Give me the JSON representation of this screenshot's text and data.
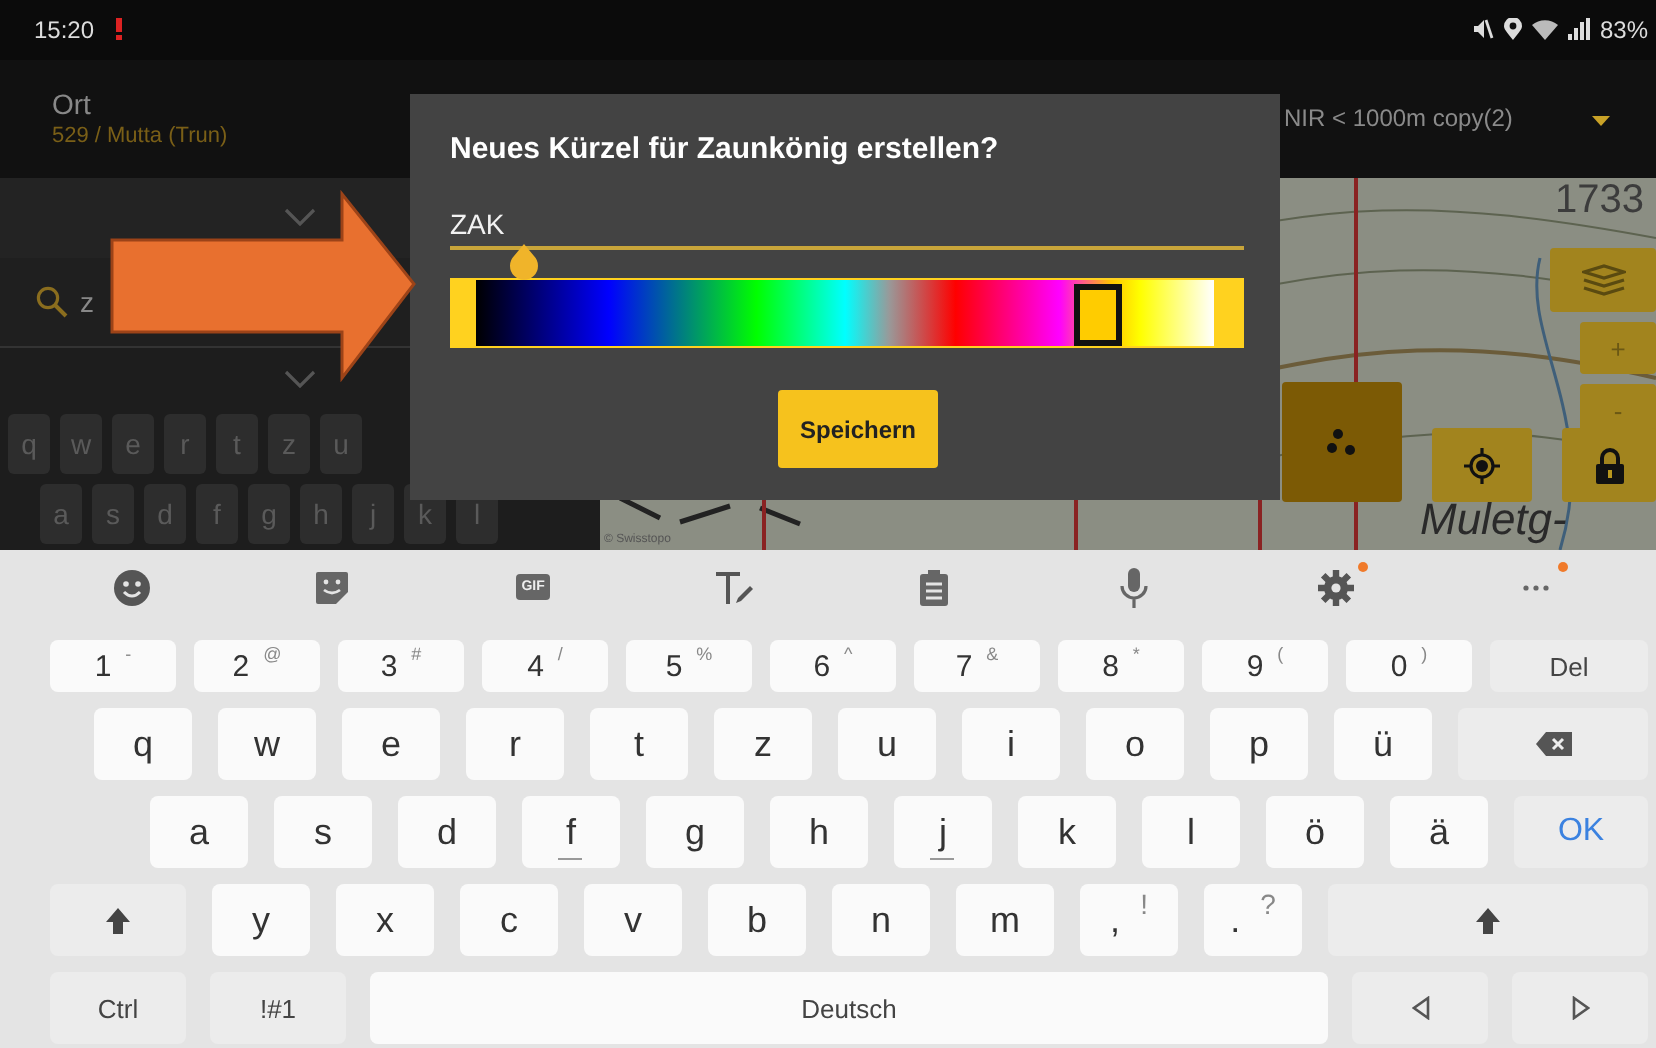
{
  "status_bar": {
    "time": "15:20",
    "battery": "83%"
  },
  "header": {
    "title": "Ort",
    "subtitle": "529 / Mutta (Trun)",
    "layer": "NIR < 1000m copy(2)"
  },
  "search": {
    "value": "z"
  },
  "background_keyboard": [
    [
      "q",
      "w",
      "e",
      "r",
      "t",
      "z",
      "u"
    ],
    [
      "a",
      "s",
      "d",
      "f",
      "g",
      "h",
      "j",
      "k",
      "l"
    ]
  ],
  "map": {
    "elevation": "1733",
    "place": "Muletg-",
    "attribution": "© Swisstopo"
  },
  "map_controls": [
    {
      "kind": "layers"
    },
    {
      "kind": "zoom",
      "label": "+"
    },
    {
      "kind": "zoom",
      "label": "-"
    },
    {
      "kind": "cluster"
    },
    {
      "kind": "locate"
    },
    {
      "kind": "lock"
    }
  ],
  "dialog": {
    "title": "Neues Kürzel für Zaunkönig erstellen?",
    "input": {
      "value": "ZAK"
    },
    "color_slider": {
      "level": 0.84
    },
    "button": "Speichern"
  },
  "keyboard": {
    "toolbar": [
      {
        "kind": "emoji",
        "badge": false
      },
      {
        "kind": "sticker",
        "badge": false
      },
      {
        "kind": "gif",
        "label": "GIF",
        "badge": false
      },
      {
        "kind": "text-style",
        "badge": false
      },
      {
        "kind": "clipboard",
        "badge": false
      },
      {
        "kind": "mic",
        "badge": false
      },
      {
        "kind": "settings",
        "badge": true
      },
      {
        "kind": "more",
        "badge": true
      }
    ],
    "number_row": [
      {
        "kind": "num",
        "label": "1",
        "sup": "-"
      },
      {
        "kind": "num",
        "label": "2",
        "sup": "@"
      },
      {
        "kind": "num",
        "label": "3",
        "sup": "#"
      },
      {
        "kind": "num",
        "label": "4",
        "sup": "/"
      },
      {
        "kind": "num",
        "label": "5",
        "sup": "%"
      },
      {
        "kind": "num",
        "label": "6",
        "sup": "^"
      },
      {
        "kind": "num",
        "label": "7",
        "sup": "&"
      },
      {
        "kind": "num",
        "label": "8",
        "sup": "*"
      },
      {
        "kind": "num",
        "label": "9",
        "sup": "("
      },
      {
        "kind": "num",
        "label": "0",
        "sup": ")"
      },
      {
        "kind": "text",
        "label": "Del"
      }
    ],
    "rows": [
      {
        "keys": [
          {
            "kind": "char",
            "label": "q"
          },
          {
            "kind": "char",
            "label": "w"
          },
          {
            "kind": "char",
            "label": "e"
          },
          {
            "kind": "char",
            "label": "r"
          },
          {
            "kind": "char",
            "label": "t"
          },
          {
            "kind": "char",
            "label": "z"
          },
          {
            "kind": "char",
            "label": "u"
          },
          {
            "kind": "char",
            "label": "i"
          },
          {
            "kind": "char",
            "label": "o"
          },
          {
            "kind": "char",
            "label": "p"
          },
          {
            "kind": "char",
            "label": "ü"
          },
          {
            "kind": "backspace"
          }
        ]
      },
      {
        "keys": [
          {
            "kind": "char",
            "label": "a",
            "homing": false
          },
          {
            "kind": "char",
            "label": "s",
            "homing": false
          },
          {
            "kind": "char",
            "label": "d",
            "homing": false
          },
          {
            "kind": "char",
            "label": "f",
            "homing": true
          },
          {
            "kind": "char",
            "label": "g",
            "homing": false
          },
          {
            "kind": "char",
            "label": "h",
            "homing": false
          },
          {
            "kind": "char",
            "label": "j",
            "homing": true
          },
          {
            "kind": "char",
            "label": "k",
            "homing": false
          },
          {
            "kind": "char",
            "label": "l",
            "homing": false
          },
          {
            "kind": "char",
            "label": "ö",
            "homing": false
          },
          {
            "kind": "char",
            "label": "ä",
            "homing": false
          },
          {
            "kind": "ok",
            "label": "OK"
          }
        ]
      },
      {
        "keys": [
          {
            "kind": "shift"
          },
          {
            "kind": "char",
            "label": "y"
          },
          {
            "kind": "char",
            "label": "x"
          },
          {
            "kind": "char",
            "label": "c"
          },
          {
            "kind": "char",
            "label": "v"
          },
          {
            "kind": "char",
            "label": "b"
          },
          {
            "kind": "char",
            "label": "n"
          },
          {
            "kind": "char",
            "label": "m"
          },
          {
            "kind": "char",
            "label": ",",
            "sup": "!"
          },
          {
            "kind": "char",
            "label": ".",
            "sup": "?"
          },
          {
            "kind": "shift"
          }
        ]
      },
      {
        "keys": [
          {
            "kind": "text",
            "label": "Ctrl"
          },
          {
            "kind": "text",
            "label": "!#1"
          },
          {
            "kind": "space",
            "label": "Deutsch"
          },
          {
            "kind": "left"
          },
          {
            "kind": "right"
          }
        ]
      }
    ]
  }
}
